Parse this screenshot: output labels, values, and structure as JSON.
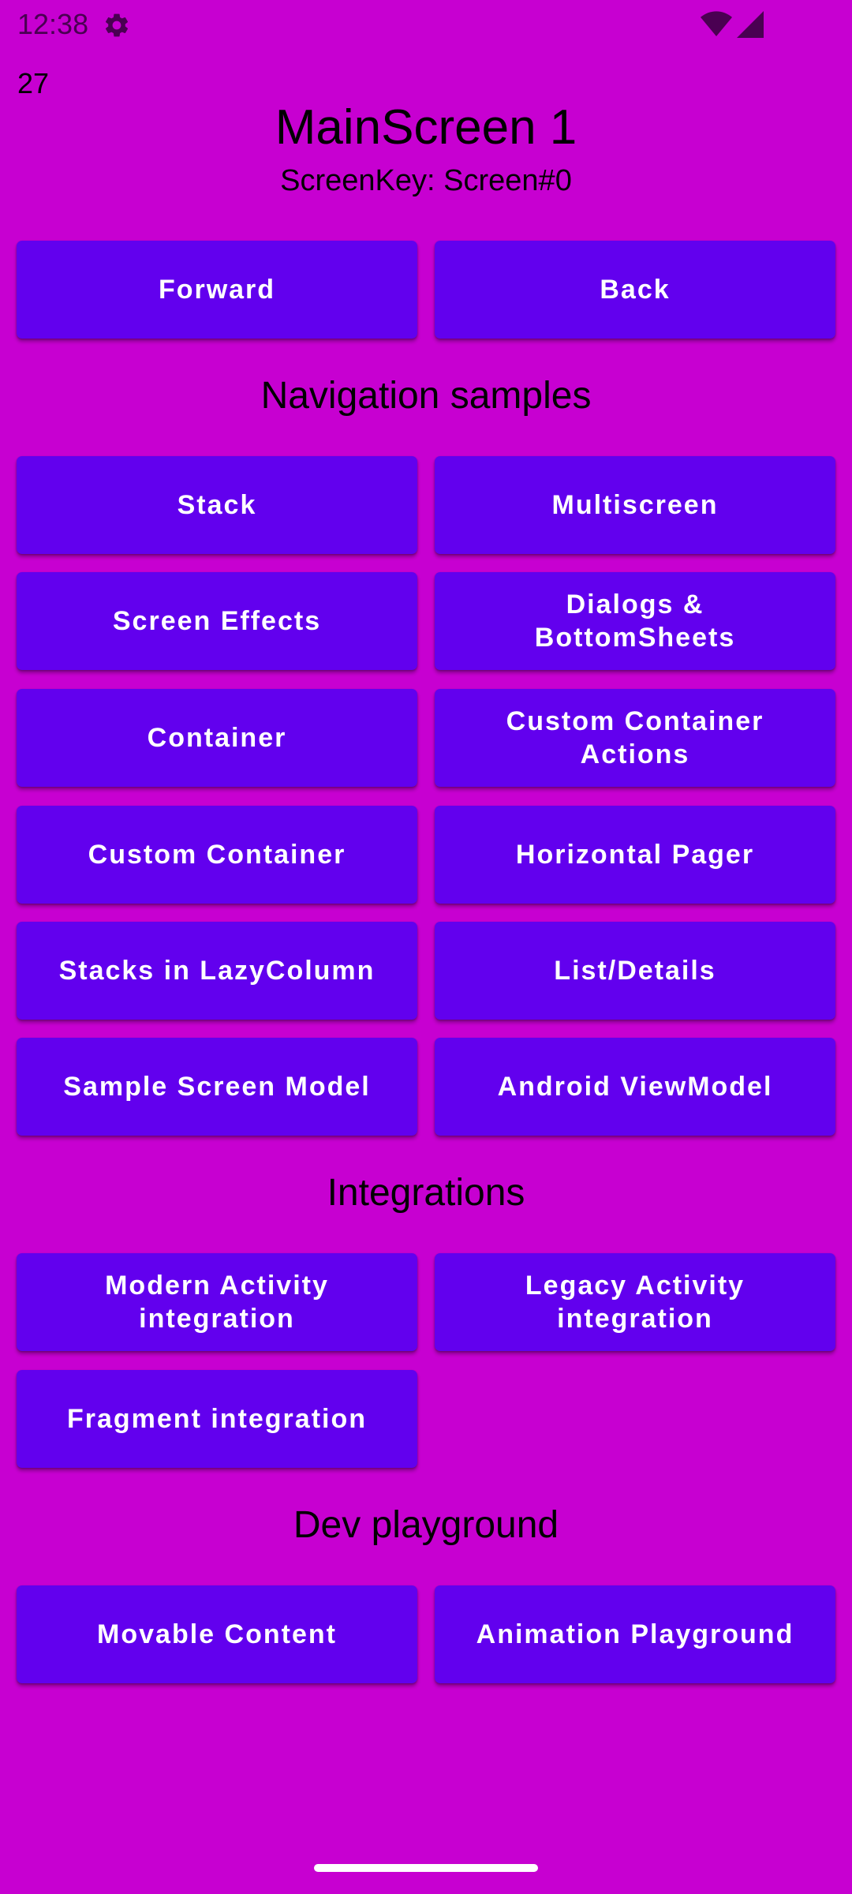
{
  "status_bar": {
    "time": "12:38",
    "icons": [
      "settings-icon",
      "wifi-icon",
      "signal-icon"
    ]
  },
  "counter": "27",
  "header": {
    "title": "MainScreen 1",
    "subtitle": "ScreenKey: Screen#0"
  },
  "nav_buttons": {
    "forward": "Forward",
    "back": "Back"
  },
  "sections": {
    "navigation_samples": "Navigation samples",
    "integrations": "Integrations",
    "dev_playground": "Dev playground"
  },
  "navigation_samples": [
    "Stack",
    "Multiscreen",
    "Screen Effects",
    "Dialogs & BottomSheets",
    "Container",
    "Custom Container Actions",
    "Custom Container",
    "Horizontal Pager",
    "Stacks in LazyColumn",
    "List/Details",
    "Sample Screen Model",
    "Android ViewModel"
  ],
  "integrations": [
    "Modern Activity integration",
    "Legacy Activity integration",
    "Fragment integration"
  ],
  "dev_playground": [
    "Movable Content",
    "Animation Playground"
  ],
  "colors": {
    "background": "#C700D1",
    "button": "#6200EE",
    "button_text": "#FFFFFF"
  }
}
